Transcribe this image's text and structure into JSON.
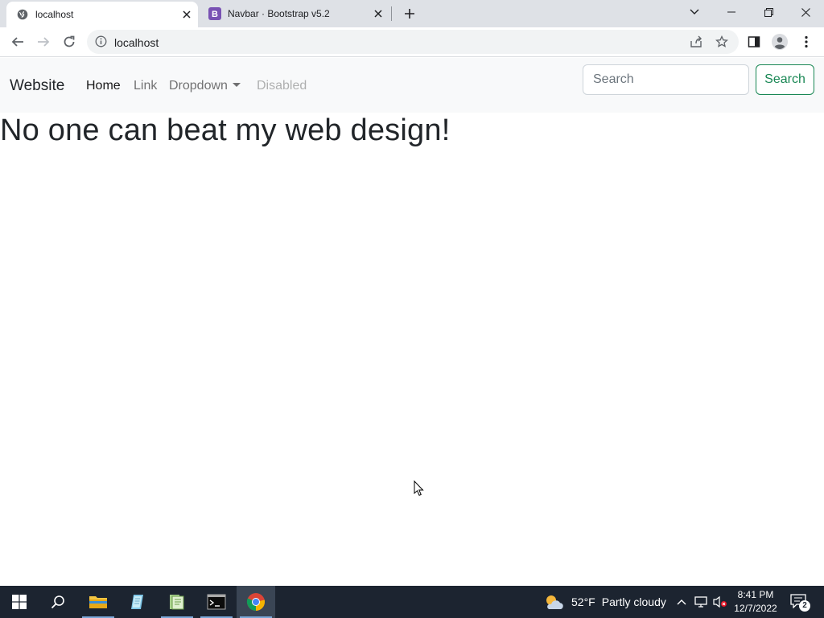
{
  "browser": {
    "tabs": [
      {
        "title": "localhost",
        "favicon": "globe-icon",
        "active": true
      },
      {
        "title": "Navbar · Bootstrap v5.2",
        "favicon": "bootstrap-icon",
        "favicon_letter": "B",
        "active": false
      }
    ],
    "address": "localhost"
  },
  "page": {
    "brand": "Website",
    "nav": {
      "home": "Home",
      "link": "Link",
      "dropdown": "Dropdown",
      "disabled": "Disabled"
    },
    "search": {
      "placeholder": "Search",
      "button_label": "Search"
    },
    "headline": "No one can beat my web design!"
  },
  "taskbar": {
    "weather_temp": "52°F",
    "weather_desc": "Partly cloudy",
    "time": "8:41 PM",
    "date": "12/7/2022",
    "notification_count": "2"
  },
  "colors": {
    "navbar_bg": "#f8f9fa",
    "success": "#198754",
    "bootstrap_purple": "#7952b3",
    "taskbar_bg": "#1c2430"
  }
}
